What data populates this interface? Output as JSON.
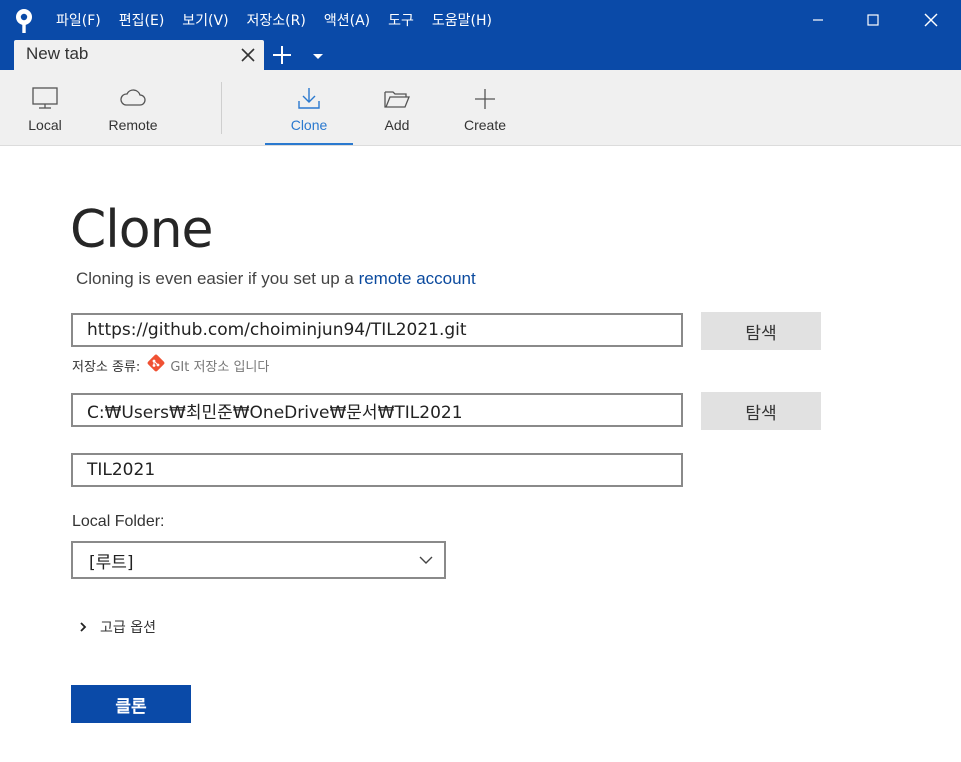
{
  "app": {
    "logo_icon": "sourcetree-logo-icon",
    "menu": [
      "파일(F)",
      "편집(E)",
      "보기(V)",
      "저장소(R)",
      "액션(A)",
      "도구",
      "도움말(H)"
    ]
  },
  "tabs": [
    {
      "label": "New tab"
    }
  ],
  "toolbar": {
    "items": [
      {
        "label": "Local",
        "icon": "monitor-icon"
      },
      {
        "label": "Remote",
        "icon": "cloud-icon"
      },
      {
        "label": "Clone",
        "icon": "download-icon",
        "active": true
      },
      {
        "label": "Add",
        "icon": "folder-open-icon"
      },
      {
        "label": "Create",
        "icon": "plus-icon"
      }
    ]
  },
  "clone": {
    "title": "Clone",
    "subtitle_prefix": "Cloning is even easier if you set up a ",
    "subtitle_link": "remote account",
    "url_value": "https://github.com/choiminjun94/TIL2021.git",
    "browse_label": "탐색",
    "repo_type_label": "저장소 종류:",
    "repo_type_value": "GIt 저장소 입니다",
    "path_value": "C:₩Users₩최민준₩OneDrive₩문서₩TIL2021",
    "name_value": "TIL2021",
    "local_folder_label": "Local Folder:",
    "local_folder_value": "[루트]",
    "advanced_label": "고급 옵션",
    "clone_button": "클론"
  },
  "colors": {
    "brand": "#0a4aa8",
    "active_tab": "#2a79cf",
    "link": "#0b4a9e",
    "git": "#f05133"
  }
}
